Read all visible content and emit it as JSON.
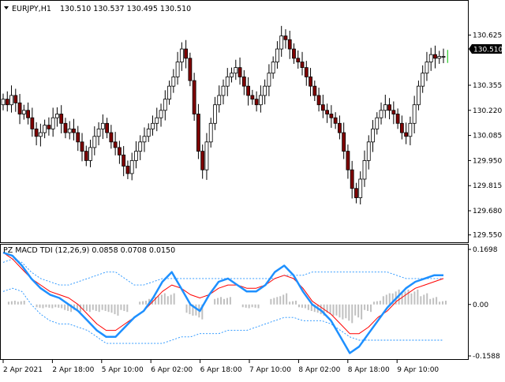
{
  "main_chart": {
    "symbol": "EURJPY,H1",
    "ohlc": "130.510 130.537 130.495 130.510",
    "price_scale": [
      "130.625",
      "130.355",
      "130.220",
      "130.085",
      "129.950",
      "129.815",
      "129.680",
      "129.550"
    ],
    "current_price": "130.510"
  },
  "indicator": {
    "header": "PZ MACD TDI (12,26,9) 0.0858 0.0708 0.0150",
    "scale": [
      "0.1698",
      "0.00",
      "-0.1588"
    ]
  },
  "time_axis": [
    "2 Apr 2021",
    "2 Apr 18:00",
    "5 Apr 10:00",
    "6 Apr 02:00",
    "6 Apr 18:00",
    "7 Apr 10:00",
    "8 Apr 02:00",
    "8 Apr 18:00",
    "9 Apr 10:00"
  ],
  "colors": {
    "bull": "#ffffff",
    "bear": "#800000",
    "outline": "#000000",
    "macd": "#1e90ff",
    "signal": "#ff0000",
    "band": "#1e90ff",
    "histogram": "#c0c0c0",
    "current_tick": "#00c000"
  },
  "chart_data": [
    {
      "type": "candlestick",
      "title": "EURJPY,H1",
      "ylim": [
        129.54,
        130.72
      ],
      "close": [
        130.28,
        130.25,
        130.3,
        130.26,
        130.2,
        130.22,
        130.18,
        130.12,
        130.08,
        130.1,
        130.14,
        130.12,
        130.18,
        130.2,
        130.15,
        130.1,
        130.12,
        130.1,
        130.05,
        130.0,
        129.95,
        130.02,
        130.08,
        130.12,
        130.15,
        130.1,
        130.05,
        130.02,
        129.98,
        129.92,
        129.88,
        129.95,
        130.0,
        130.05,
        130.08,
        130.12,
        130.15,
        130.18,
        130.22,
        130.28,
        130.35,
        130.4,
        130.48,
        130.55,
        130.5,
        130.38,
        130.2,
        130.0,
        129.9,
        130.05,
        130.15,
        130.25,
        130.3,
        130.35,
        130.4,
        130.42,
        130.45,
        130.4,
        130.35,
        130.3,
        130.28,
        130.25,
        130.3,
        130.35,
        130.42,
        130.48,
        130.55,
        130.62,
        130.6,
        130.55,
        130.5,
        130.48,
        130.45,
        130.4,
        130.35,
        130.3,
        130.25,
        130.22,
        130.2,
        130.18,
        130.15,
        130.1,
        130.0,
        129.9,
        129.8,
        129.75,
        129.85,
        129.95,
        130.05,
        130.12,
        130.18,
        130.22,
        130.25,
        130.22,
        130.2,
        130.15,
        130.1,
        130.08,
        130.15,
        130.25,
        130.35,
        130.42,
        130.48,
        130.52,
        130.5,
        130.51,
        130.51
      ]
    },
    {
      "type": "line",
      "title": "PZ MACD TDI (12,26,9)",
      "ylim": [
        -0.1588,
        0.1698
      ],
      "series": [
        {
          "role": "macd",
          "values": [
            0.16,
            0.15,
            0.12,
            0.08,
            0.05,
            0.03,
            0.02,
            0.0,
            -0.02,
            -0.05,
            -0.08,
            -0.1,
            -0.1,
            -0.07,
            -0.04,
            -0.02,
            0.02,
            0.07,
            0.1,
            0.05,
            0.0,
            -0.02,
            0.03,
            0.07,
            0.08,
            0.06,
            0.04,
            0.04,
            0.06,
            0.1,
            0.12,
            0.09,
            0.04,
            0.0,
            -0.02,
            -0.05,
            -0.1,
            -0.15,
            -0.13,
            -0.09,
            -0.05,
            -0.01,
            0.02,
            0.05,
            0.07,
            0.08,
            0.09,
            0.09
          ]
        },
        {
          "role": "signal",
          "values": [
            0.16,
            0.14,
            0.11,
            0.08,
            0.06,
            0.04,
            0.03,
            0.02,
            0.0,
            -0.03,
            -0.06,
            -0.08,
            -0.08,
            -0.06,
            -0.04,
            -0.02,
            0.01,
            0.04,
            0.06,
            0.05,
            0.03,
            0.02,
            0.03,
            0.05,
            0.06,
            0.06,
            0.05,
            0.05,
            0.06,
            0.08,
            0.09,
            0.08,
            0.05,
            0.01,
            -0.01,
            -0.03,
            -0.06,
            -0.09,
            -0.09,
            -0.07,
            -0.04,
            -0.02,
            0.01,
            0.03,
            0.05,
            0.06,
            0.07,
            0.08
          ]
        },
        {
          "role": "upper-band",
          "values": [
            0.13,
            0.14,
            0.13,
            0.1,
            0.08,
            0.07,
            0.06,
            0.06,
            0.07,
            0.08,
            0.09,
            0.1,
            0.1,
            0.08,
            0.06,
            0.06,
            0.07,
            0.08,
            0.08,
            0.08,
            0.08,
            0.08,
            0.08,
            0.08,
            0.08,
            0.08,
            0.08,
            0.08,
            0.08,
            0.08,
            0.09,
            0.09,
            0.09,
            0.1,
            0.1,
            0.1,
            0.1,
            0.1,
            0.1,
            0.1,
            0.1,
            0.1,
            0.09,
            0.08,
            0.08,
            0.08,
            0.08,
            0.08
          ]
        },
        {
          "role": "lower-band",
          "values": [
            0.04,
            0.05,
            0.04,
            0.0,
            -0.03,
            -0.05,
            -0.06,
            -0.06,
            -0.07,
            -0.08,
            -0.1,
            -0.12,
            -0.12,
            -0.12,
            -0.12,
            -0.12,
            -0.12,
            -0.12,
            -0.11,
            -0.1,
            -0.1,
            -0.09,
            -0.09,
            -0.09,
            -0.08,
            -0.08,
            -0.08,
            -0.07,
            -0.06,
            -0.05,
            -0.04,
            -0.04,
            -0.05,
            -0.05,
            -0.05,
            -0.06,
            -0.08,
            -0.1,
            -0.11,
            -0.11,
            -0.11,
            -0.11,
            -0.11,
            -0.11,
            -0.11,
            -0.11,
            -0.11,
            -0.11
          ]
        },
        {
          "role": "histogram",
          "values": [
            0.0,
            0.01,
            0.01,
            0.0,
            -0.01,
            -0.01,
            -0.01,
            -0.02,
            -0.02,
            -0.02,
            -0.02,
            -0.02,
            -0.03,
            -0.02,
            0.0,
            0.01,
            0.02,
            0.03,
            0.03,
            0.0,
            -0.03,
            -0.04,
            0.0,
            0.02,
            0.02,
            0.0,
            -0.01,
            -0.01,
            0.0,
            0.02,
            0.03,
            0.01,
            -0.01,
            -0.02,
            -0.03,
            -0.03,
            -0.04,
            -0.05,
            -0.04,
            -0.02,
            0.01,
            0.03,
            0.04,
            0.04,
            0.04,
            0.03,
            0.02,
            0.01
          ]
        }
      ]
    }
  ]
}
